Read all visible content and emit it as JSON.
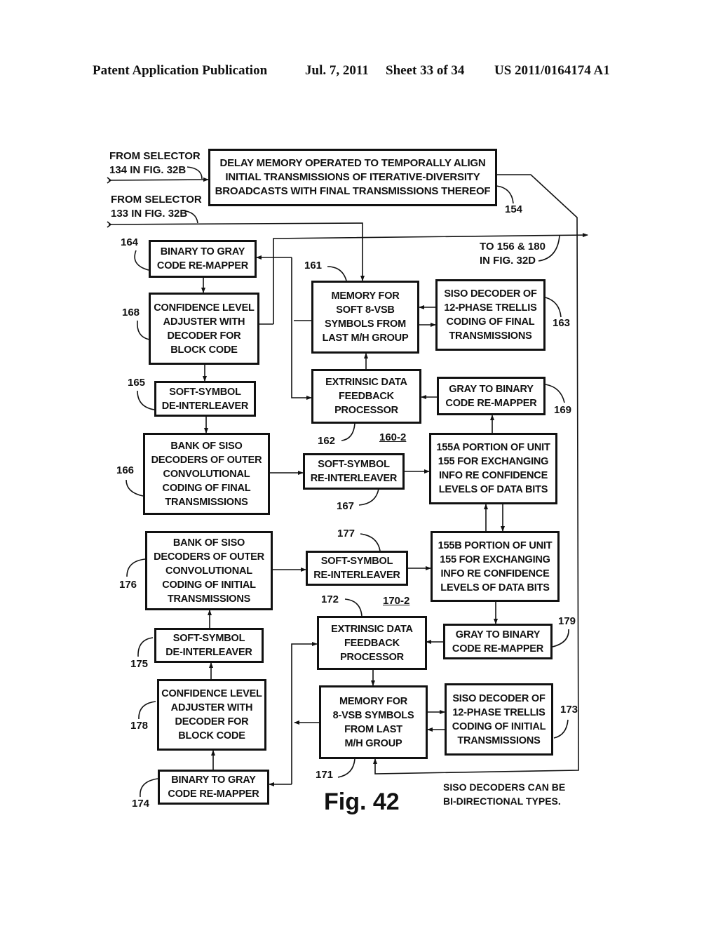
{
  "header": {
    "publication": "Patent Application Publication",
    "date": "Jul. 7, 2011",
    "sheet": "Sheet 33 of 34",
    "number": "US 2011/0164174 A1"
  },
  "inputs": {
    "from_134": "FROM SELECTOR\n134 IN FIG. 32B",
    "from_133": "FROM SELECTOR\n133 IN FIG. 32B",
    "to_156_180": "TO 156 & 180\nIN FIG. 32D"
  },
  "blocks": {
    "b154": {
      "ref": "154",
      "text": "DELAY MEMORY OPERATED TO TEMPORALLY ALIGN\nINITIAL TRANSMISSIONS OF ITERATIVE-DIVERSITY\nBROADCASTS WITH FINAL TRANSMISSIONS THEREOF"
    },
    "b164": {
      "ref": "164",
      "text": "BINARY TO GRAY\nCODE RE-MAPPER"
    },
    "b168": {
      "ref": "168",
      "text": "CONFIDENCE LEVEL\nADJUSTER WITH\nDECODER FOR\nBLOCK CODE"
    },
    "b161": {
      "ref": "161",
      "text": "MEMORY FOR\nSOFT 8-VSB\nSYMBOLS FROM\nLAST M/H GROUP"
    },
    "b163": {
      "ref": "163",
      "text": "SISO DECODER OF\n12-PHASE TRELLIS\nCODING OF FINAL\nTRANSMISSIONS"
    },
    "b165": {
      "ref": "165",
      "text": "SOFT-SYMBOL\nDE-INTERLEAVER"
    },
    "b162": {
      "ref": "162",
      "text": "EXTRINSIC DATA\nFEEDBACK\nPROCESSOR"
    },
    "b169": {
      "ref": "169",
      "text": "GRAY TO BINARY\nCODE RE-MAPPER"
    },
    "b166": {
      "ref": "166",
      "text": "BANK OF SISO\nDECODERS OF OUTER\nCONVOLUTIONAL\nCODING OF FINAL\nTRANSMISSIONS"
    },
    "b167": {
      "ref": "167",
      "text": "SOFT-SYMBOL\nRE-INTERLEAVER"
    },
    "b155a": {
      "text": "155A PORTION OF UNIT\n155 FOR EXCHANGING\nINFO RE CONFIDENCE\nLEVELS OF DATA BITS"
    },
    "b176": {
      "ref": "176",
      "text": "BANK OF SISO\nDECODERS OF OUTER\nCONVOLUTIONAL\nCODING OF INITIAL\nTRANSMISSIONS"
    },
    "b177": {
      "ref": "177",
      "text": "SOFT-SYMBOL\nRE-INTERLEAVER"
    },
    "b155b": {
      "text": "155B PORTION OF UNIT\n155 FOR EXCHANGING\nINFO RE CONFIDENCE\nLEVELS OF DATA BITS"
    },
    "b175": {
      "ref": "175",
      "text": "SOFT-SYMBOL\nDE-INTERLEAVER"
    },
    "b172": {
      "ref": "172",
      "text": "EXTRINSIC DATA\nFEEDBACK\nPROCESSOR"
    },
    "b179": {
      "ref": "179",
      "text": "GRAY TO BINARY\nCODE RE-MAPPER"
    },
    "b178": {
      "ref": "178",
      "text": "CONFIDENCE LEVEL\nADJUSTER WITH\nDECODER FOR\nBLOCK CODE"
    },
    "b171": {
      "ref": "171",
      "text": "MEMORY FOR\n8-VSB SYMBOLS\nFROM LAST\nM/H GROUP"
    },
    "b173": {
      "ref": "173",
      "text": "SISO DECODER OF\n12-PHASE TRELLIS\nCODING OF INITIAL\nTRANSMISSIONS"
    },
    "b174": {
      "ref": "174",
      "text": "BINARY TO GRAY\nCODE RE-MAPPER"
    }
  },
  "groups": {
    "g160": "160-2",
    "g170": "170-2"
  },
  "figure_label": "Fig. 42",
  "note": "SISO DECODERS CAN BE\nBI-DIRECTIONAL TYPES."
}
